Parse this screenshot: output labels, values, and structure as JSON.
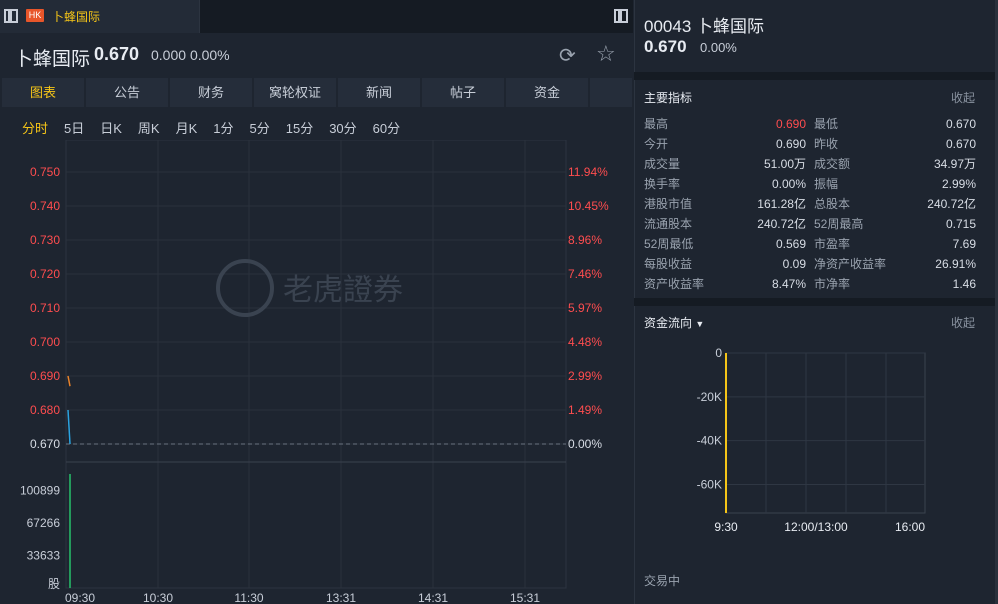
{
  "tab": {
    "badge": "HK",
    "name": "卜蜂国际"
  },
  "header": {
    "title": "卜蜂国际",
    "price": "0.670",
    "change": "0.000",
    "change_pct": "0.00%"
  },
  "nav_tabs": [
    {
      "label": "图表",
      "active": true
    },
    {
      "label": "公告",
      "active": false
    },
    {
      "label": "财务",
      "active": false
    },
    {
      "label": "窝轮权证",
      "active": false
    },
    {
      "label": "新闻",
      "active": false
    },
    {
      "label": "帖子",
      "active": false
    },
    {
      "label": "资金",
      "active": false
    },
    {
      "label": "",
      "active": false
    }
  ],
  "periods": [
    {
      "label": "分时",
      "active": true
    },
    {
      "label": "5日",
      "active": false
    },
    {
      "label": "日K",
      "active": false
    },
    {
      "label": "周K",
      "active": false
    },
    {
      "label": "月K",
      "active": false
    },
    {
      "label": "1分",
      "active": false
    },
    {
      "label": "5分",
      "active": false
    },
    {
      "label": "15分",
      "active": false
    },
    {
      "label": "30分",
      "active": false
    },
    {
      "label": "60分",
      "active": false
    }
  ],
  "watermark": "老虎證券",
  "chart_data": [
    {
      "type": "line",
      "name": "intraday",
      "y_left_ticks": [
        "0.750",
        "0.740",
        "0.730",
        "0.720",
        "0.710",
        "0.700",
        "0.690",
        "0.680",
        "0.670"
      ],
      "y_right_ticks": [
        "11.94%",
        "10.45%",
        "8.96%",
        "7.46%",
        "5.97%",
        "4.48%",
        "2.99%",
        "1.49%",
        "0.00%"
      ],
      "ylim": [
        0.67,
        0.75
      ],
      "prev_close": 0.67,
      "volume_ticks": [
        "100899",
        "67266",
        "33633",
        "股"
      ],
      "x_ticks": [
        "09:30",
        "10:30",
        "11:30",
        "13:31",
        "14:31",
        "15:31"
      ],
      "price_series": [
        0.69,
        0.687
      ],
      "avg_series": [
        0.68,
        0.67
      ],
      "volume_series": [
        118000
      ]
    },
    {
      "type": "area",
      "name": "capital-flow",
      "y_ticks": [
        "0",
        "-20K",
        "-40K",
        "-60K"
      ],
      "x_ticks": [
        "9:30",
        "12:00/13:00",
        "16:00"
      ],
      "ylim": [
        -73000,
        0
      ],
      "values": [
        0,
        -73000
      ]
    }
  ],
  "right": {
    "code": "00043",
    "name": "卜蜂国际",
    "price": "0.670",
    "change_pct": "0.00%",
    "metrics_title": "主要指标",
    "collapse": "收起",
    "metrics": [
      {
        "l1": "最高",
        "v1": "0.690",
        "red1": true,
        "l2": "最低",
        "v2": "0.670"
      },
      {
        "l1": "今开",
        "v1": "0.690",
        "red1": false,
        "l2": "昨收",
        "v2": "0.670"
      },
      {
        "l1": "成交量",
        "v1": "51.00万",
        "red1": false,
        "l2": "成交额",
        "v2": "34.97万"
      },
      {
        "l1": "换手率",
        "v1": "0.00%",
        "red1": false,
        "l2": "振幅",
        "v2": "2.99%"
      },
      {
        "l1": "港股市值",
        "v1": "161.28亿",
        "red1": false,
        "l2": "总股本",
        "v2": "240.72亿"
      },
      {
        "l1": "流通股本",
        "v1": "240.72亿",
        "red1": false,
        "l2": "52周最高",
        "v2": "0.715"
      },
      {
        "l1": "52周最低",
        "v1": "0.569",
        "red1": false,
        "l2": "市盈率",
        "v2": "7.69"
      },
      {
        "l1": "每股收益",
        "v1": "0.09",
        "red1": false,
        "l2": "净资产收益率",
        "v2": "26.91%"
      },
      {
        "l1": "资产收益率",
        "v1": "8.47%",
        "red1": false,
        "l2": "市净率",
        "v2": "1.46"
      }
    ],
    "flow_title": "资金流向",
    "flow_collapse": "收起",
    "status": "交易中"
  },
  "colors": {
    "accent": "#f5c518",
    "red": "#ff4d4f",
    "blue": "#2aa3e0",
    "orange": "#e8822a",
    "green": "#27c26b"
  }
}
